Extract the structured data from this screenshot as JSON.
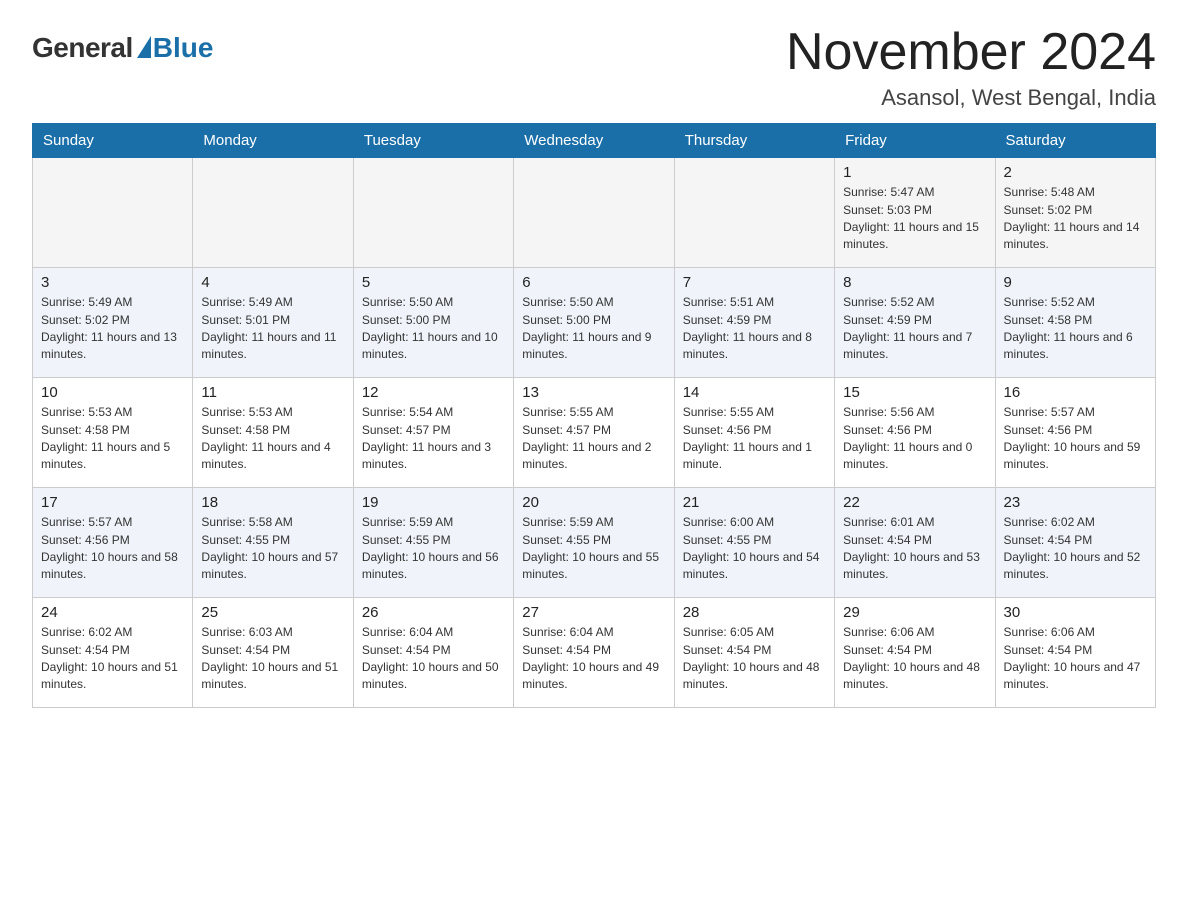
{
  "header": {
    "logo_general": "General",
    "logo_blue": "Blue",
    "title": "November 2024",
    "subtitle": "Asansol, West Bengal, India"
  },
  "weekdays": [
    "Sunday",
    "Monday",
    "Tuesday",
    "Wednesday",
    "Thursday",
    "Friday",
    "Saturday"
  ],
  "weeks": [
    [
      {
        "day": "",
        "info": ""
      },
      {
        "day": "",
        "info": ""
      },
      {
        "day": "",
        "info": ""
      },
      {
        "day": "",
        "info": ""
      },
      {
        "day": "",
        "info": ""
      },
      {
        "day": "1",
        "info": "Sunrise: 5:47 AM\nSunset: 5:03 PM\nDaylight: 11 hours and 15 minutes."
      },
      {
        "day": "2",
        "info": "Sunrise: 5:48 AM\nSunset: 5:02 PM\nDaylight: 11 hours and 14 minutes."
      }
    ],
    [
      {
        "day": "3",
        "info": "Sunrise: 5:49 AM\nSunset: 5:02 PM\nDaylight: 11 hours and 13 minutes."
      },
      {
        "day": "4",
        "info": "Sunrise: 5:49 AM\nSunset: 5:01 PM\nDaylight: 11 hours and 11 minutes."
      },
      {
        "day": "5",
        "info": "Sunrise: 5:50 AM\nSunset: 5:00 PM\nDaylight: 11 hours and 10 minutes."
      },
      {
        "day": "6",
        "info": "Sunrise: 5:50 AM\nSunset: 5:00 PM\nDaylight: 11 hours and 9 minutes."
      },
      {
        "day": "7",
        "info": "Sunrise: 5:51 AM\nSunset: 4:59 PM\nDaylight: 11 hours and 8 minutes."
      },
      {
        "day": "8",
        "info": "Sunrise: 5:52 AM\nSunset: 4:59 PM\nDaylight: 11 hours and 7 minutes."
      },
      {
        "day": "9",
        "info": "Sunrise: 5:52 AM\nSunset: 4:58 PM\nDaylight: 11 hours and 6 minutes."
      }
    ],
    [
      {
        "day": "10",
        "info": "Sunrise: 5:53 AM\nSunset: 4:58 PM\nDaylight: 11 hours and 5 minutes."
      },
      {
        "day": "11",
        "info": "Sunrise: 5:53 AM\nSunset: 4:58 PM\nDaylight: 11 hours and 4 minutes."
      },
      {
        "day": "12",
        "info": "Sunrise: 5:54 AM\nSunset: 4:57 PM\nDaylight: 11 hours and 3 minutes."
      },
      {
        "day": "13",
        "info": "Sunrise: 5:55 AM\nSunset: 4:57 PM\nDaylight: 11 hours and 2 minutes."
      },
      {
        "day": "14",
        "info": "Sunrise: 5:55 AM\nSunset: 4:56 PM\nDaylight: 11 hours and 1 minute."
      },
      {
        "day": "15",
        "info": "Sunrise: 5:56 AM\nSunset: 4:56 PM\nDaylight: 11 hours and 0 minutes."
      },
      {
        "day": "16",
        "info": "Sunrise: 5:57 AM\nSunset: 4:56 PM\nDaylight: 10 hours and 59 minutes."
      }
    ],
    [
      {
        "day": "17",
        "info": "Sunrise: 5:57 AM\nSunset: 4:56 PM\nDaylight: 10 hours and 58 minutes."
      },
      {
        "day": "18",
        "info": "Sunrise: 5:58 AM\nSunset: 4:55 PM\nDaylight: 10 hours and 57 minutes."
      },
      {
        "day": "19",
        "info": "Sunrise: 5:59 AM\nSunset: 4:55 PM\nDaylight: 10 hours and 56 minutes."
      },
      {
        "day": "20",
        "info": "Sunrise: 5:59 AM\nSunset: 4:55 PM\nDaylight: 10 hours and 55 minutes."
      },
      {
        "day": "21",
        "info": "Sunrise: 6:00 AM\nSunset: 4:55 PM\nDaylight: 10 hours and 54 minutes."
      },
      {
        "day": "22",
        "info": "Sunrise: 6:01 AM\nSunset: 4:54 PM\nDaylight: 10 hours and 53 minutes."
      },
      {
        "day": "23",
        "info": "Sunrise: 6:02 AM\nSunset: 4:54 PM\nDaylight: 10 hours and 52 minutes."
      }
    ],
    [
      {
        "day": "24",
        "info": "Sunrise: 6:02 AM\nSunset: 4:54 PM\nDaylight: 10 hours and 51 minutes."
      },
      {
        "day": "25",
        "info": "Sunrise: 6:03 AM\nSunset: 4:54 PM\nDaylight: 10 hours and 51 minutes."
      },
      {
        "day": "26",
        "info": "Sunrise: 6:04 AM\nSunset: 4:54 PM\nDaylight: 10 hours and 50 minutes."
      },
      {
        "day": "27",
        "info": "Sunrise: 6:04 AM\nSunset: 4:54 PM\nDaylight: 10 hours and 49 minutes."
      },
      {
        "day": "28",
        "info": "Sunrise: 6:05 AM\nSunset: 4:54 PM\nDaylight: 10 hours and 48 minutes."
      },
      {
        "day": "29",
        "info": "Sunrise: 6:06 AM\nSunset: 4:54 PM\nDaylight: 10 hours and 48 minutes."
      },
      {
        "day": "30",
        "info": "Sunrise: 6:06 AM\nSunset: 4:54 PM\nDaylight: 10 hours and 47 minutes."
      }
    ]
  ]
}
